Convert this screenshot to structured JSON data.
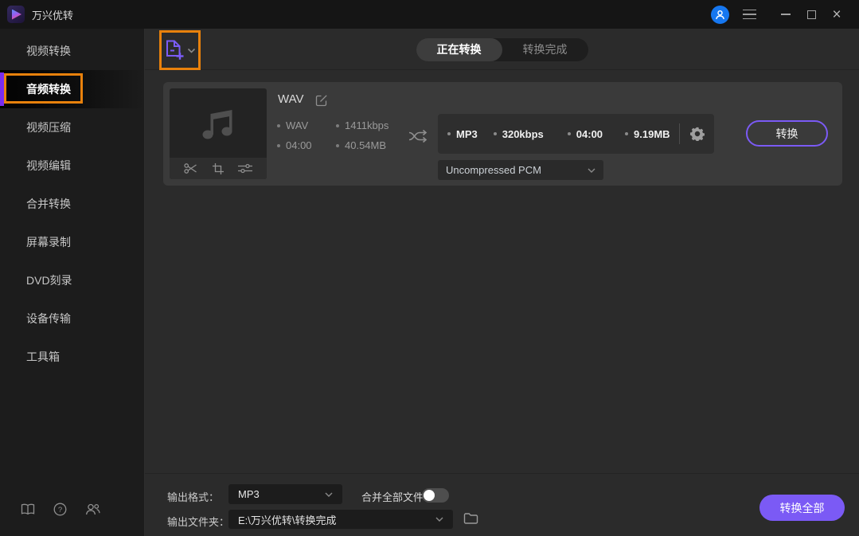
{
  "titlebar": {
    "app_title": "万兴优转"
  },
  "sidebar": {
    "items": [
      {
        "label": "视频转换",
        "active": false
      },
      {
        "label": "音频转换",
        "active": true,
        "annotated": true
      },
      {
        "label": "视频压缩",
        "active": false
      },
      {
        "label": "视频编辑",
        "active": false
      },
      {
        "label": "合并转换",
        "active": false
      },
      {
        "label": "屏幕录制",
        "active": false
      },
      {
        "label": "DVD刻录",
        "active": false
      },
      {
        "label": "设备传输",
        "active": false
      },
      {
        "label": "工具箱",
        "active": false
      }
    ]
  },
  "tabs": {
    "converting": "正在转换",
    "finished": "转换完成"
  },
  "file_card": {
    "title": "WAV",
    "source": {
      "format": "WAV",
      "bitrate": "1411kbps",
      "duration": "04:00",
      "size": "40.54MB"
    },
    "output": {
      "format": "MP3",
      "bitrate": "320kbps",
      "duration": "04:00",
      "size": "9.19MB"
    },
    "codec": "Uncompressed PCM",
    "convert_label": "转换"
  },
  "bottom_bar": {
    "output_format_label": "输出格式：",
    "output_format_value": "MP3",
    "merge_all_label": "合并全部文件",
    "merge_all_on": false,
    "output_folder_label": "输出文件夹：",
    "output_folder_path": "E:\\万兴优转\\转换完成",
    "convert_all_label": "转换全部"
  },
  "icons": {
    "logo": "play-triangle",
    "titlebar_right": [
      "user-avatar",
      "menu",
      "minimize",
      "maximize",
      "close"
    ],
    "add_file": "document-plus",
    "thumbnail": "beamed-music-notes",
    "thumbnail_tools": [
      "scissors",
      "crop",
      "adjust-sliders"
    ],
    "file_title_action": "edit-pencil",
    "between_panels": "shuffle-arrows",
    "output_settings": "gear",
    "folder_picker": "folder",
    "sidebar_footer": [
      "guide-book",
      "help-question",
      "contact-people"
    ]
  },
  "colors": {
    "accent_purple": "#7b5af5",
    "annotation_orange": "#e8810c",
    "avatar_blue": "#1677f0",
    "sidebar_active_bar": "#7a2df0"
  }
}
